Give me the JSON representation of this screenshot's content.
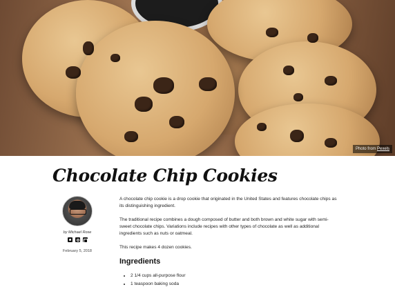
{
  "hero": {
    "credit_prefix": "Photo from",
    "credit_link": "Pexels"
  },
  "post": {
    "title": "Chocolate Chip Cookies",
    "author_line": "by Michael Rose",
    "date": "February 5, 2018",
    "social_icons": [
      "twitter-icon",
      "instagram-icon",
      "github-icon"
    ],
    "paragraphs": [
      "A chocolate chip cookie is a drop cookie that originated in the United States and features chocolate chips as its distinguishing ingredient.",
      "The traditional recipe combines a dough composed of butter and both brown and white sugar with semi-sweet chocolate chips. Variations include recipes with other types of chocolate as well as additional ingredients such as nuts or oatmeal.",
      "This recipe makes 4 dozen cookies."
    ],
    "ingredients_heading": "Ingredients",
    "ingredients": [
      "2 1/4 cups all-purpose flour",
      "1 teaspoon baking soda"
    ]
  }
}
